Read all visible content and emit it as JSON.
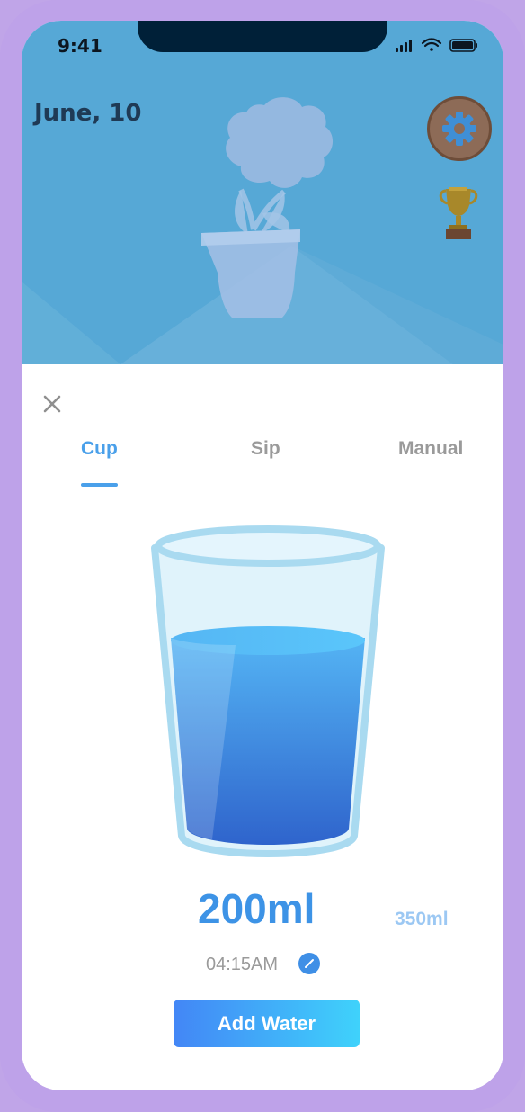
{
  "status_bar": {
    "time": "9:41"
  },
  "header": {
    "date": "June, 10"
  },
  "icons": {
    "settings": "gear-icon",
    "trophy": "trophy-icon",
    "close": "close-icon",
    "edit": "edit-pencil-icon"
  },
  "tabs": [
    {
      "label": "Cup",
      "active": true
    },
    {
      "label": "Sip",
      "active": false
    },
    {
      "label": "Manual",
      "active": false
    }
  ],
  "cup": {
    "amount": "200ml",
    "alternate_amount": "350ml",
    "time": "04:15AM"
  },
  "actions": {
    "add_label": "Add Water"
  },
  "colors": {
    "accent": "#4aa0ea",
    "header_bg": "#56a8d6",
    "button_start": "#4386f6",
    "button_end": "#3fd2fb",
    "frame": "#bea2e9"
  }
}
